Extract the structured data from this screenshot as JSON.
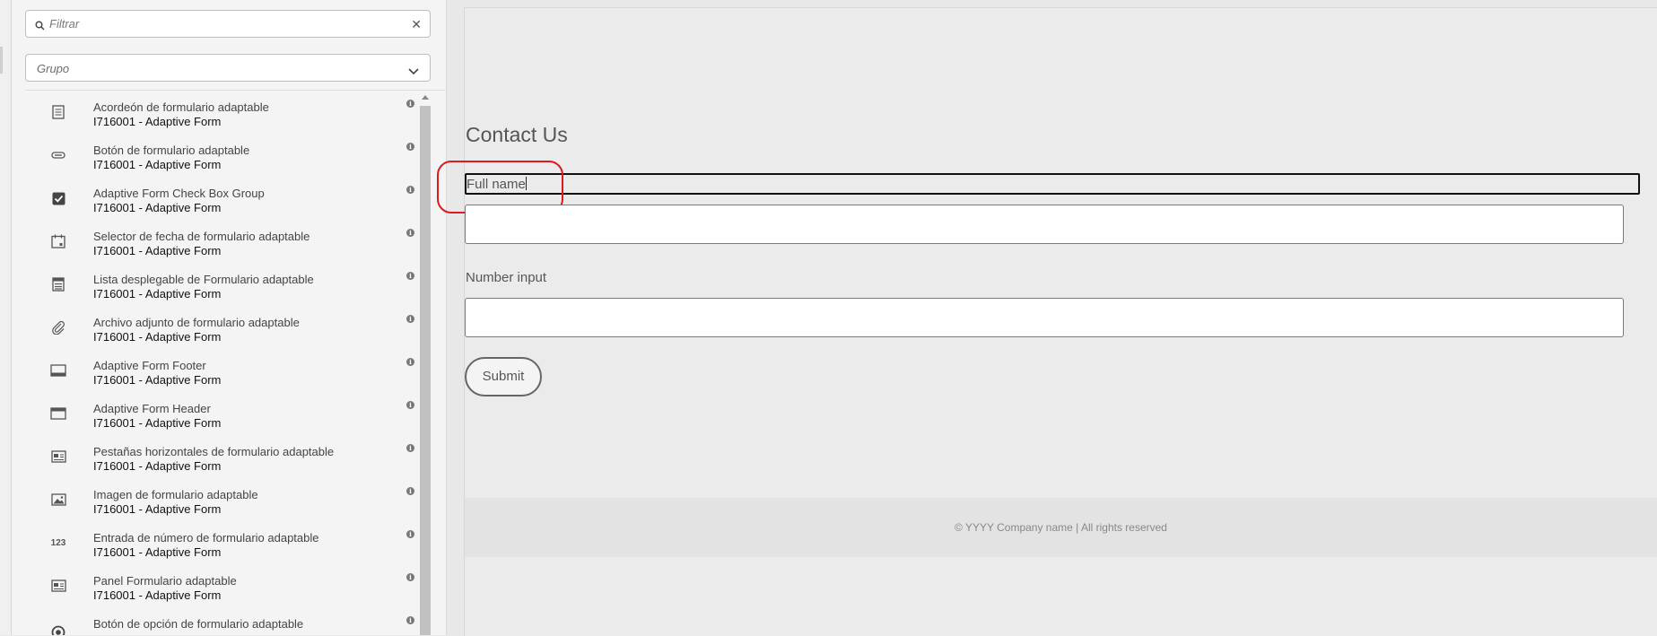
{
  "sidebar": {
    "filter": {
      "placeholder": "Filtrar",
      "clear_icon": "close-icon"
    },
    "group": {
      "placeholder": "Grupo"
    },
    "items": [
      {
        "icon": "accordion-icon",
        "name": "Acordeón de formulario adaptable",
        "group": "I716001 - Adaptive Form"
      },
      {
        "icon": "button-icon",
        "name": "Botón de formulario adaptable",
        "group": "I716001 - Adaptive Form"
      },
      {
        "icon": "checkbox-icon",
        "name": "Adaptive Form Check Box Group",
        "group": "I716001 - Adaptive Form"
      },
      {
        "icon": "calendar-icon",
        "name": "Selector de fecha de formulario adaptable",
        "group": "I716001 - Adaptive Form"
      },
      {
        "icon": "dropdown-list-icon",
        "name": "Lista desplegable de Formulario adaptable",
        "group": "I716001 - Adaptive Form"
      },
      {
        "icon": "paperclip-icon",
        "name": "Archivo adjunto de formulario adaptable",
        "group": "I716001 - Adaptive Form"
      },
      {
        "icon": "footer-icon",
        "name": "Adaptive Form Footer",
        "group": "I716001 - Adaptive Form"
      },
      {
        "icon": "header-icon",
        "name": "Adaptive Form Header",
        "group": "I716001 - Adaptive Form"
      },
      {
        "icon": "tabs-icon",
        "name": "Pestañas horizontales de formulario adaptable",
        "group": "I716001 - Adaptive Form"
      },
      {
        "icon": "image-icon",
        "name": "Imagen de formulario adaptable",
        "group": "I716001 - Adaptive Form"
      },
      {
        "icon": "number-icon",
        "name": "Entrada de número de formulario adaptable",
        "group": "I716001 - Adaptive Form",
        "glyph": "123"
      },
      {
        "icon": "panel-icon",
        "name": "Panel Formulario adaptable",
        "group": "I716001 - Adaptive Form"
      },
      {
        "icon": "radio-icon",
        "name": "Botón de opción de formulario adaptable",
        "group": ""
      }
    ]
  },
  "form": {
    "title": "Contact Us",
    "full_name_label": "Full name",
    "number_label": "Number input",
    "submit_label": "Submit"
  },
  "footer": {
    "text": "© YYYY Company name | All rights reserved"
  },
  "colors": {
    "highlight": "#e0191e",
    "canvas": "#ebebeb",
    "panel": "#f4f4f4"
  }
}
